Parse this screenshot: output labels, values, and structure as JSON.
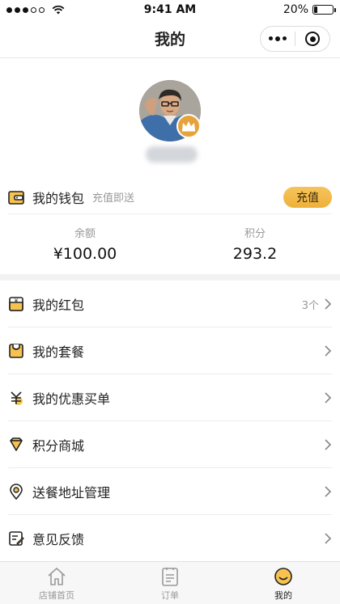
{
  "status_bar": {
    "time": "9:41 AM",
    "battery": "20%",
    "battery_level": 0.2
  },
  "nav": {
    "title": "我的"
  },
  "wallet": {
    "title": "我的钱包",
    "subtitle": "充值即送",
    "recharge_label": "充值",
    "balance_label": "余额",
    "balance_value": "¥100.00",
    "points_label": "积分",
    "points_value": "293.2"
  },
  "menu": [
    {
      "label": "我的红包",
      "count": "3个",
      "icon": "red-packet-icon"
    },
    {
      "label": "我的套餐",
      "count": "",
      "icon": "package-bag-icon"
    },
    {
      "label": "我的优惠买单",
      "count": "",
      "icon": "yuan-discount-icon"
    },
    {
      "label": "积分商城",
      "count": "",
      "icon": "diamond-icon"
    },
    {
      "label": "送餐地址管理",
      "count": "",
      "icon": "location-pin-icon"
    },
    {
      "label": "意见反馈",
      "count": "",
      "icon": "feedback-edit-icon"
    }
  ],
  "tabbar": [
    {
      "label": "店铺首页",
      "icon": "home-icon",
      "active": false
    },
    {
      "label": "订单",
      "icon": "order-list-icon",
      "active": false
    },
    {
      "label": "我的",
      "icon": "smiley-face-icon",
      "active": true
    }
  ],
  "colors": {
    "accent": "#eeb13a",
    "accent_light": "#f6c45c",
    "divider": "#ececec"
  }
}
